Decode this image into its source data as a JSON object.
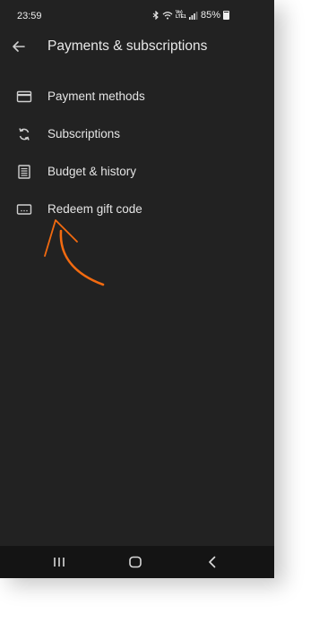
{
  "status_bar": {
    "time": "23:59",
    "network": "Vo) LTE1",
    "battery_percent": "85%",
    "icons": [
      "bluetooth-icon",
      "wifi-icon",
      "volte-icon",
      "signal-icon",
      "battery-icon"
    ]
  },
  "header": {
    "title": "Payments & subscriptions",
    "back_icon": "arrow-back-icon"
  },
  "menu": {
    "items": [
      {
        "label": "Payment methods",
        "icon": "credit-card-icon"
      },
      {
        "label": "Subscriptions",
        "icon": "sync-icon"
      },
      {
        "label": "Budget & history",
        "icon": "receipt-list-icon"
      },
      {
        "label": "Redeem gift code",
        "icon": "gift-card-icon"
      }
    ]
  },
  "annotation": {
    "type": "hand-drawn-arrow",
    "color": "#f26a10",
    "points_to": "Redeem gift code"
  },
  "nav_bar": {
    "buttons": [
      "recents-icon",
      "home-icon",
      "back-icon"
    ]
  },
  "colors": {
    "screen_background": "#222222",
    "text": "#e4e4e4",
    "icon": "#cfcfcf",
    "nav_background": "#141414"
  }
}
